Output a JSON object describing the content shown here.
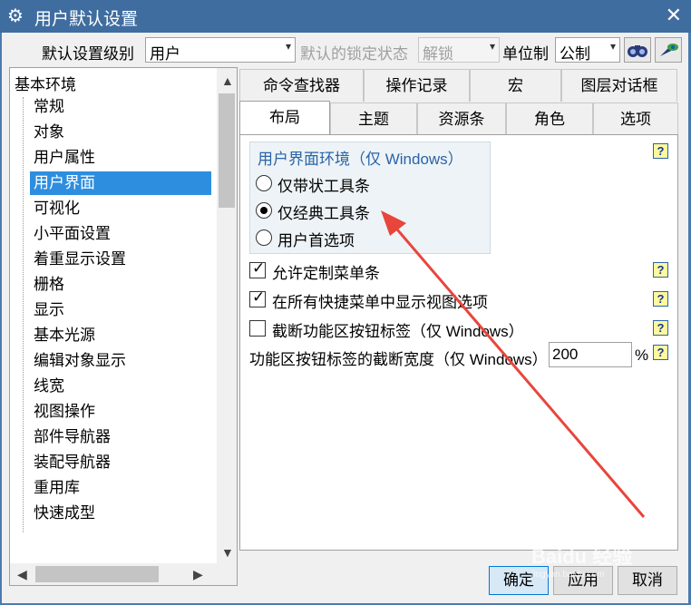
{
  "window": {
    "title": "用户默认设置",
    "close_glyph": "✕"
  },
  "toolbar": {
    "level_label": "默认设置级别",
    "level_value": "用户",
    "lock_label": "默认的锁定状态",
    "lock_value": "解锁",
    "unit_label": "单位制",
    "unit_value": "公制",
    "dropdown_glyph": "▾"
  },
  "tree": {
    "root": "基本环境",
    "items": [
      "常规",
      "对象",
      "用户属性",
      "用户界面",
      "可视化",
      "小平面设置",
      "着重显示设置",
      "栅格",
      "显示",
      "基本光源",
      "编辑对象显示",
      "线宽",
      "视图操作",
      "部件导航器",
      "装配导航器",
      "重用库",
      "快速成型"
    ],
    "selected_index": 3
  },
  "tabs_row1": [
    "命令查找器",
    "操作记录",
    "宏",
    "图层对话框"
  ],
  "tabs_row2": [
    "布局",
    "主题",
    "资源条",
    "角色",
    "选项"
  ],
  "active_tab": "布局",
  "panel": {
    "group_title": "用户界面环境（仅 Windows）",
    "radios": [
      "仅带状工具条",
      "仅经典工具条",
      "用户首选项"
    ],
    "radio_selected": 1,
    "checkboxes": [
      {
        "label": "允许定制菜单条",
        "checked": true
      },
      {
        "label": "在所有快捷菜单中显示视图选项",
        "checked": true
      },
      {
        "label": "截断功能区按钮标签（仅 Windows）",
        "checked": false
      }
    ],
    "width_label": "功能区按钮标签的截断宽度（仅 Windows）",
    "width_value": "200",
    "width_unit": "%",
    "help_glyph": "?"
  },
  "buttons": {
    "ok": "确定",
    "apply": "应用",
    "cancel": "取消"
  },
  "watermark": {
    "brand": "Baidu 经验",
    "url": "jingyan.baidu.com"
  },
  "annotation": {
    "arrow_color": "#e8453c"
  },
  "icons": [
    "gear-icon",
    "close-icon",
    "binoculars-icon",
    "pin-icon",
    "chevron-up-icon",
    "chevron-down-icon",
    "chevron-left-icon",
    "chevron-right-icon",
    "help-icon"
  ]
}
